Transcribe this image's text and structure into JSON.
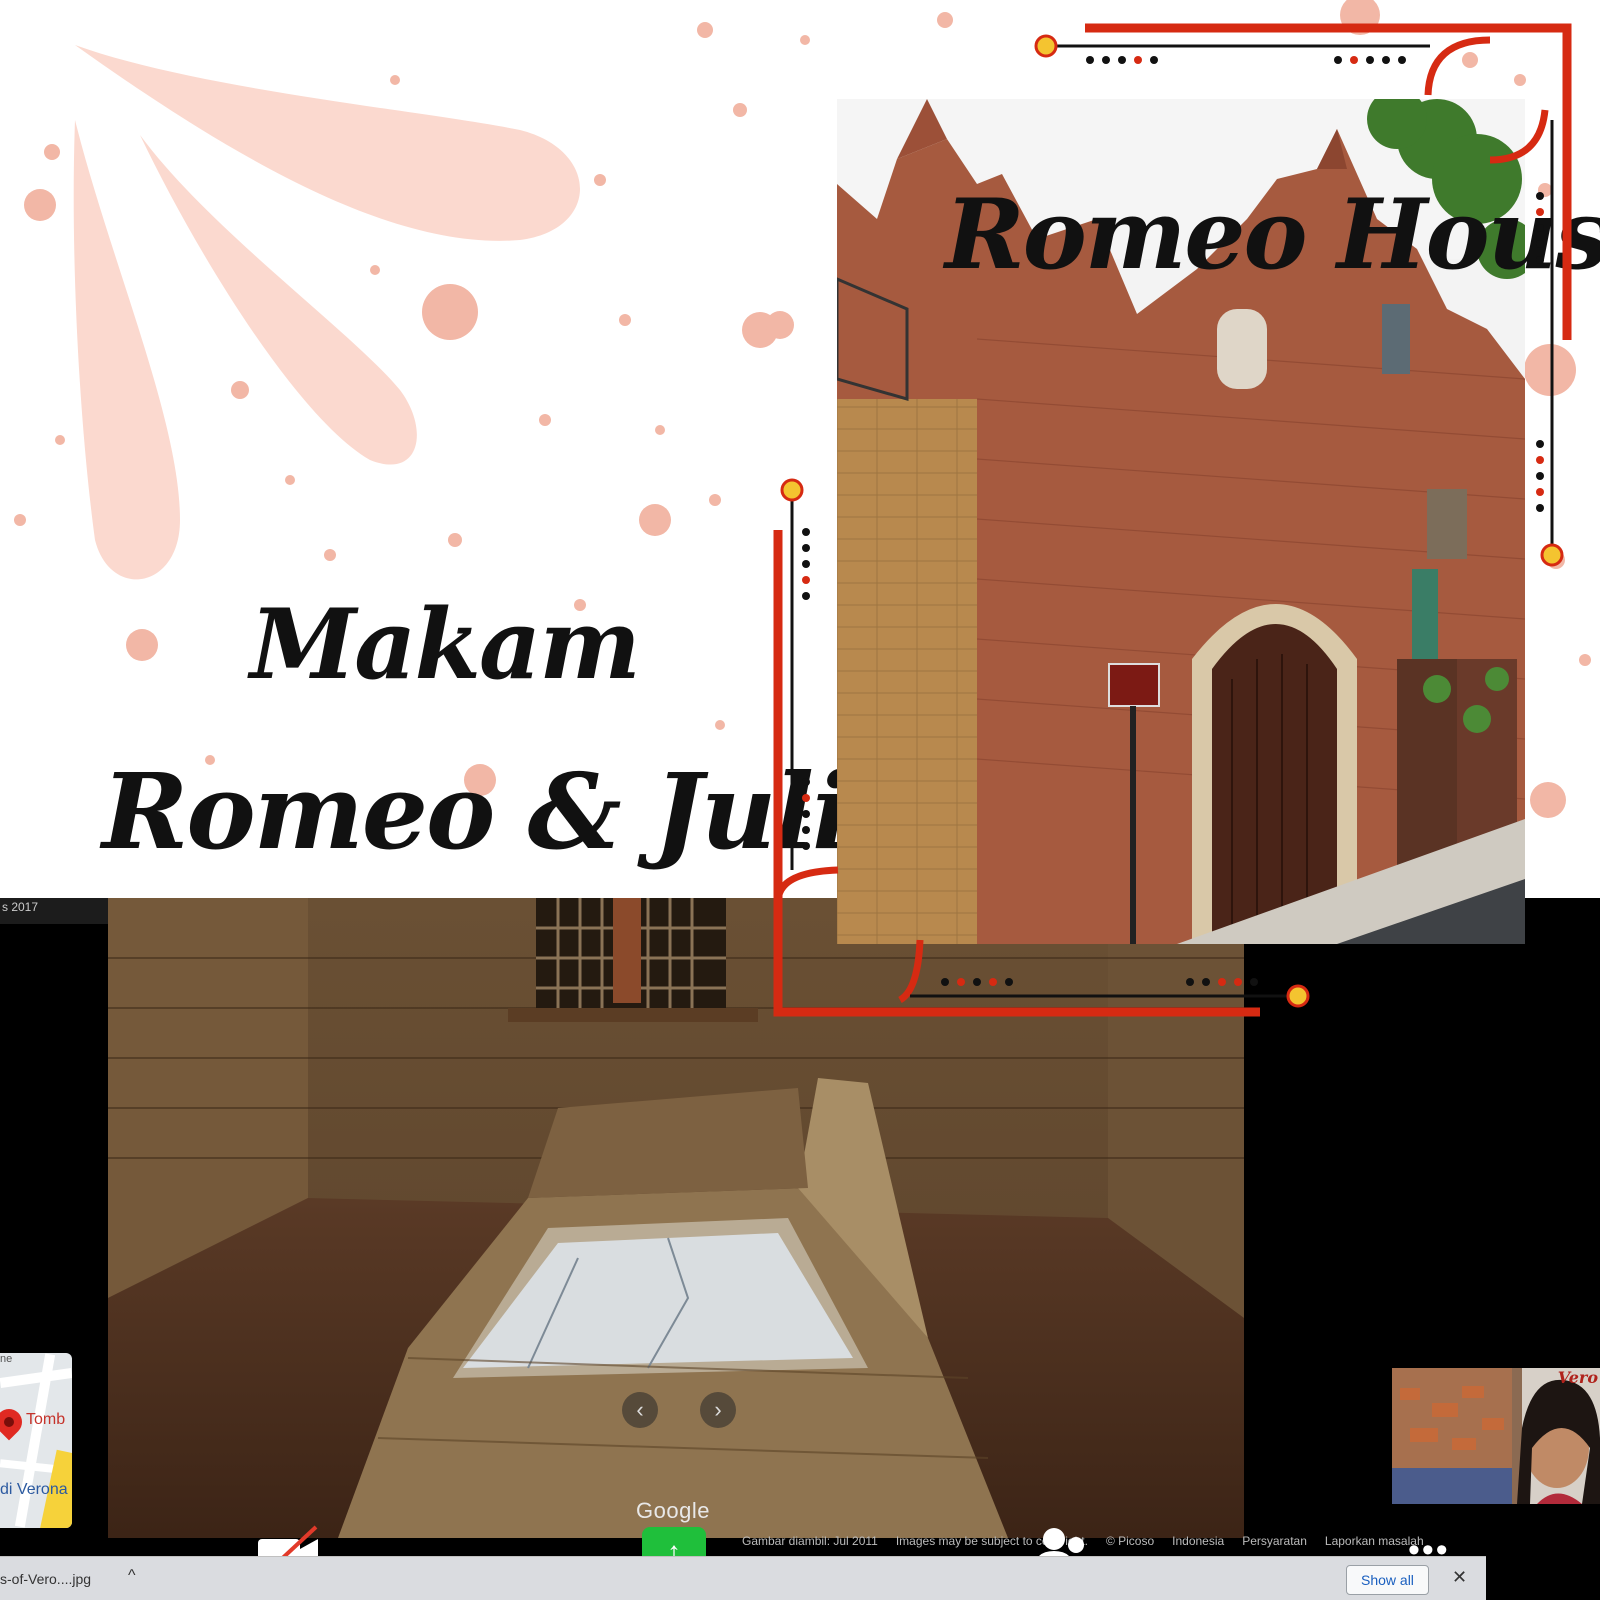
{
  "slide": {
    "title_left_line1": "Makam",
    "title_left_line2": "Romeo  & Juliet",
    "title_right": "Romeo House"
  },
  "street_view": {
    "corner_date": "s 2017",
    "prev_icon": "chevron-left-icon",
    "next_icon": "chevron-right-icon",
    "brand": "Google",
    "footer": [
      "Gambar diambil: Jul 2011",
      "Images may be subject to copyright.",
      "© Picoso",
      "Indonesia",
      "Persyaratan",
      "Laporkan masalah"
    ]
  },
  "map_thumb": {
    "label_place": "Tomb",
    "label_city": "di Verona",
    "label_top": "ne"
  },
  "webcam": {
    "name": "Vero"
  },
  "toolbar": {
    "camera_icon": "video-off-icon",
    "share_icon": "share-screen-icon",
    "participants_icon": "participants-icon",
    "more_label": "•••"
  },
  "downloads": {
    "file_name": "s-of-Vero....jpg",
    "chevron": "^",
    "show_all": "Show all",
    "close": "✕"
  },
  "colors": {
    "accent_red": "#d62a12",
    "dot_yellow": "#f4c430",
    "share_green": "#1fbf3b",
    "splash_pink": "#f6c4b6"
  }
}
